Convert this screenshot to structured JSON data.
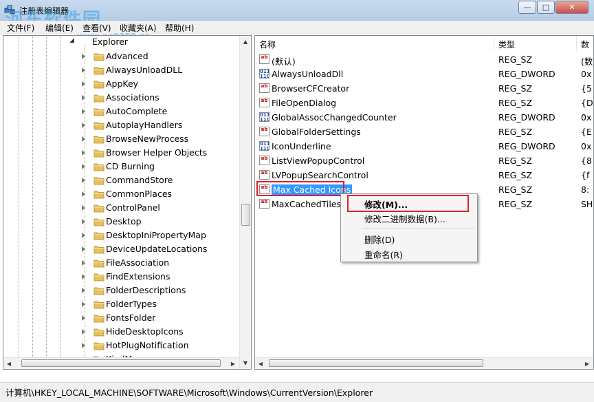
{
  "window": {
    "title": "注册表编辑器",
    "watermark": "河东软件园",
    "watermark_url": "www.pc0359.cn",
    "minimize_label": "—",
    "maximize_label": "□",
    "close_label": "✕"
  },
  "menubar": {
    "items": [
      "文件(F)",
      "编辑(E)",
      "查看(V)",
      "收藏夹(A)",
      "帮助(H)"
    ]
  },
  "tree": {
    "parent_label": "Explorer",
    "items": [
      "Advanced",
      "AlwaysUnloadDLL",
      "AppKey",
      "Associations",
      "AutoComplete",
      "AutoplayHandlers",
      "BrowseNewProcess",
      "Browser Helper Objects",
      "CD Burning",
      "CommandStore",
      "CommonPlaces",
      "ControlPanel",
      "Desktop",
      "DesktopIniPropertyMap",
      "DeviceUpdateLocations",
      "FileAssociation",
      "FindExtensions",
      "FolderDescriptions",
      "FolderTypes",
      "FontsFolder",
      "HideDesktopIcons",
      "HotPlugNotification",
      "KindMap"
    ]
  },
  "list": {
    "columns": {
      "name": "名称",
      "type": "类型",
      "data": "数"
    },
    "rows": [
      {
        "name": "(默认)",
        "type": "REG_SZ",
        "data": "(数",
        "kind": "sz"
      },
      {
        "name": "AlwaysUnloadDll",
        "type": "REG_DWORD",
        "data": "0x",
        "kind": "dw"
      },
      {
        "name": "BrowserCFCreator",
        "type": "REG_SZ",
        "data": "{5",
        "kind": "sz"
      },
      {
        "name": "FileOpenDialog",
        "type": "REG_SZ",
        "data": "{D",
        "kind": "sz"
      },
      {
        "name": "GlobalAssocChangedCounter",
        "type": "REG_DWORD",
        "data": "0x",
        "kind": "dw"
      },
      {
        "name": "GlobalFolderSettings",
        "type": "REG_SZ",
        "data": "{E",
        "kind": "sz"
      },
      {
        "name": "IconUnderline",
        "type": "REG_DWORD",
        "data": "0x",
        "kind": "dw"
      },
      {
        "name": "ListViewPopupControl",
        "type": "REG_SZ",
        "data": "{8",
        "kind": "sz"
      },
      {
        "name": "LVPopupSearchControl",
        "type": "REG_SZ",
        "data": "{f",
        "kind": "sz"
      },
      {
        "name": "Max Cached Icons",
        "type": "REG_SZ",
        "data": "8:",
        "kind": "sz",
        "selected": true
      },
      {
        "name": "MaxCachedTiles",
        "type": "REG_SZ",
        "data": "SH",
        "kind": "sz"
      }
    ]
  },
  "context_menu": {
    "modify": "修改(M)...",
    "modify_binary": "修改二进制数据(B)...",
    "delete": "删除(D)",
    "rename": "重命名(R)"
  },
  "status": {
    "path": "计算机\\HKEY_LOCAL_MACHINE\\SOFTWARE\\Microsoft\\Windows\\CurrentVersion\\Explorer"
  },
  "colors": {
    "selection": "#3399ff",
    "highlight_box": "#e0202a",
    "folder": "#e8c060"
  }
}
